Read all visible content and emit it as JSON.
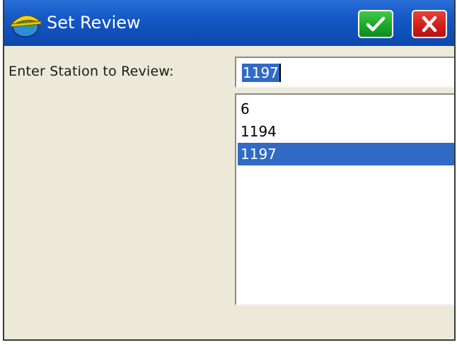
{
  "window": {
    "title": "Set Review",
    "app_icon": "hard-hat-globe-icon",
    "ok_icon": "checkmark-icon",
    "cancel_icon": "close-x-icon"
  },
  "form": {
    "station_label": "Enter Station to Review:",
    "station_value": "1197",
    "stations": [
      {
        "label": "6",
        "selected": false
      },
      {
        "label": "1194",
        "selected": false
      },
      {
        "label": "1197",
        "selected": true
      }
    ]
  },
  "colors": {
    "titlebar": "#1558c4",
    "selection": "#316ac5",
    "ok_button": "#1ca82a",
    "cancel_button": "#d41f1a",
    "dialog_background": "#ece9d8"
  }
}
